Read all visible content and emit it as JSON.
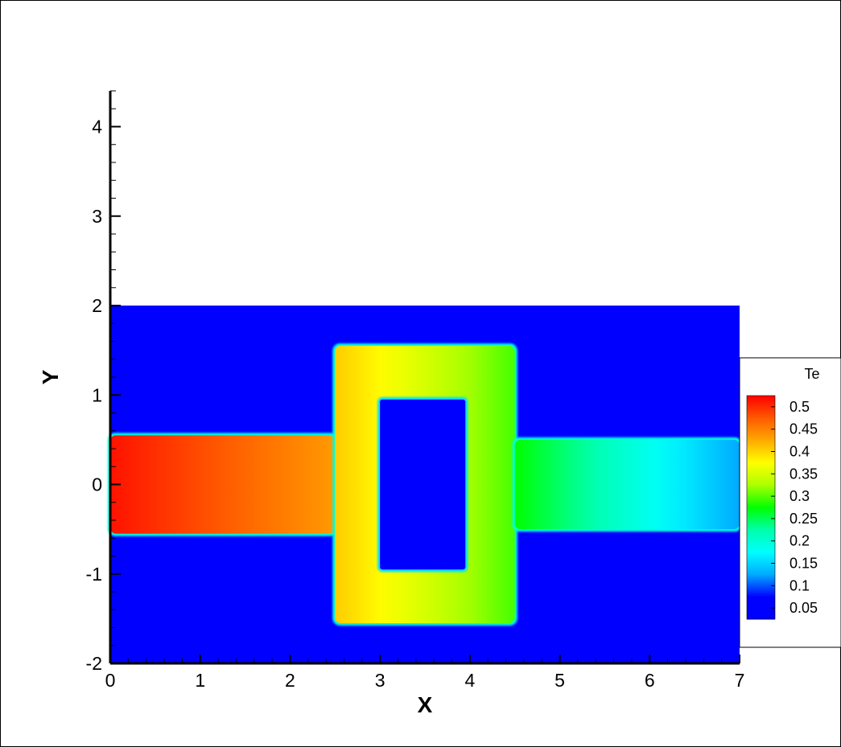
{
  "chart_data": {
    "type": "heatmap",
    "xlabel": "X",
    "ylabel": "Y",
    "xlim": [
      0,
      7
    ],
    "ylim": [
      -2,
      4.4
    ],
    "x_ticks": [
      "0",
      "1",
      "2",
      "3",
      "4",
      "5",
      "6",
      "7"
    ],
    "y_ticks": [
      "-2",
      "-1",
      "0",
      "1",
      "2",
      "3",
      "4"
    ],
    "grid": false,
    "legend": {
      "title": "Te",
      "placement": "right",
      "levels": [
        "0.5",
        "0.45",
        "0.4",
        "0.35",
        "0.3",
        "0.25",
        "0.2",
        "0.15",
        "0.1",
        "0.05"
      ],
      "colors": [
        "#ff0000",
        "#ff5a00",
        "#ffaa00",
        "#ffff00",
        "#aaff00",
        "#00ff00",
        "#00ffaa",
        "#00ffff",
        "#00aaff",
        "#0000ff"
      ]
    },
    "domain_x": [
      0,
      7
    ],
    "domain_y": [
      -2,
      2
    ],
    "background_value": 0.05,
    "regions": [
      {
        "name": "left-channel",
        "x": [
          0,
          2.5
        ],
        "y": [
          -0.55,
          0.55
        ],
        "value_start": 0.49,
        "value_end": 0.41
      },
      {
        "name": "ring",
        "x": [
          2.5,
          4.5
        ],
        "y": [
          -1.55,
          1.55
        ],
        "value_start": 0.38,
        "value_end": 0.27
      },
      {
        "name": "ring-hole",
        "x": [
          3.0,
          3.95
        ],
        "y": [
          -0.95,
          0.95
        ],
        "value": 0.05
      },
      {
        "name": "right-channel",
        "x": [
          4.5,
          7
        ],
        "y": [
          -0.5,
          0.5
        ],
        "value_start": 0.25,
        "value_end": 0.1
      }
    ]
  }
}
